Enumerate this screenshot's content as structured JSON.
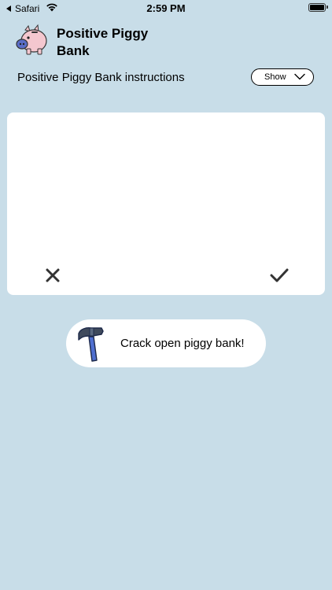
{
  "status_bar": {
    "back_label": "Safari",
    "time": "2:59 PM"
  },
  "header": {
    "app_title": "Positive Piggy Bank",
    "logo_icon": "piggy-bank-icon"
  },
  "instructions": {
    "label": "Positive Piggy Bank instructions",
    "toggle_label": "Show",
    "toggle_icon": "chevron-down-icon"
  },
  "entry_card": {
    "text": "",
    "cancel_icon": "close-icon",
    "confirm_icon": "checkmark-icon"
  },
  "crack_button": {
    "label": "Crack open piggy bank!",
    "icon": "hammer-icon"
  },
  "colors": {
    "background": "#c8dde8",
    "card": "#ffffff",
    "hammer_handle": "#4f6fd0",
    "hammer_head": "#3f4a5c",
    "piggy_pink": "#f4c7cf",
    "piggy_snout": "#5a6dc8"
  }
}
